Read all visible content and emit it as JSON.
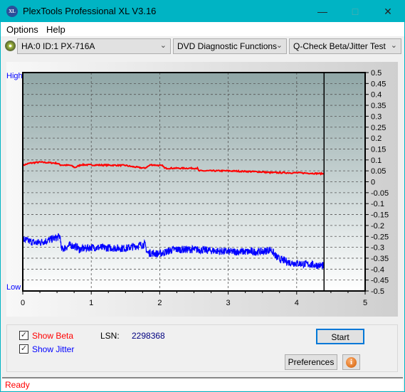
{
  "window": {
    "title": "PlexTools Professional XL V3.16",
    "logo": "XL"
  },
  "menu": [
    {
      "label": "Options"
    },
    {
      "label": "Help"
    }
  ],
  "toolbar": {
    "drive": "HA:0 ID:1  PX-716A",
    "function": "DVD Diagnostic Functions",
    "test": "Q-Check Beta/Jitter Test"
  },
  "chart_data": {
    "type": "line",
    "left_labels": {
      "high": "High",
      "low": "Low"
    },
    "xlim": [
      0,
      5
    ],
    "x_ticks": [
      "0",
      "1",
      "2",
      "3",
      "4",
      "5"
    ],
    "ylim": [
      -0.5,
      0.5
    ],
    "y_ticks": [
      "0.5",
      "0.45",
      "0.4",
      "0.35",
      "0.3",
      "0.25",
      "0.2",
      "0.15",
      "0.1",
      "0.05",
      "0",
      "-0.05",
      "-0.1",
      "-0.15",
      "-0.2",
      "-0.25",
      "-0.3",
      "-0.35",
      "-0.4",
      "-0.45",
      "-0.5"
    ],
    "grid": true,
    "marker_x": 4.4,
    "series": [
      {
        "key": "beta",
        "color": "#ff0000",
        "points": [
          [
            0,
            0.075
          ],
          [
            0.1,
            0.085
          ],
          [
            0.25,
            0.09
          ],
          [
            0.5,
            0.085
          ],
          [
            0.55,
            0.077
          ],
          [
            0.7,
            0.075
          ],
          [
            0.76,
            0.065
          ],
          [
            0.85,
            0.078
          ],
          [
            1.0,
            0.077
          ],
          [
            1.5,
            0.075
          ],
          [
            1.6,
            0.069
          ],
          [
            1.78,
            0.062
          ],
          [
            1.87,
            0.078
          ],
          [
            2.05,
            0.073
          ],
          [
            2.07,
            0.062
          ],
          [
            2.55,
            0.062
          ],
          [
            2.57,
            0.05
          ],
          [
            3.0,
            0.05
          ],
          [
            3.5,
            0.045
          ],
          [
            3.6,
            0.042
          ],
          [
            4.0,
            0.041
          ],
          [
            4.4,
            0.037
          ]
        ]
      },
      {
        "key": "jitter",
        "color": "#0000ff",
        "points": [
          [
            0,
            -0.265
          ],
          [
            0.2,
            -0.28
          ],
          [
            0.35,
            -0.27
          ],
          [
            0.55,
            -0.25
          ],
          [
            0.56,
            -0.31
          ],
          [
            0.7,
            -0.29
          ],
          [
            0.8,
            -0.3
          ],
          [
            0.82,
            -0.31
          ],
          [
            1.0,
            -0.3
          ],
          [
            1.5,
            -0.305
          ],
          [
            1.78,
            -0.285
          ],
          [
            1.82,
            -0.325
          ],
          [
            2.0,
            -0.33
          ],
          [
            2.2,
            -0.31
          ],
          [
            2.5,
            -0.31
          ],
          [
            3.0,
            -0.32
          ],
          [
            3.5,
            -0.32
          ],
          [
            3.62,
            -0.31
          ],
          [
            3.72,
            -0.35
          ],
          [
            3.9,
            -0.37
          ],
          [
            4.4,
            -0.385
          ]
        ]
      }
    ]
  },
  "controls": {
    "show_beta": "Show Beta",
    "show_jitter": "Show Jitter",
    "show_beta_checked": true,
    "show_jitter_checked": true,
    "lsn_label": "LSN:",
    "lsn_value": "2298368",
    "start": "Start",
    "preferences": "Preferences",
    "info_icon": "info-icon"
  },
  "status": "Ready",
  "colors": {
    "titlebar": "#00b4c4",
    "beta": "#ff0000",
    "jitter": "#0000ff"
  }
}
